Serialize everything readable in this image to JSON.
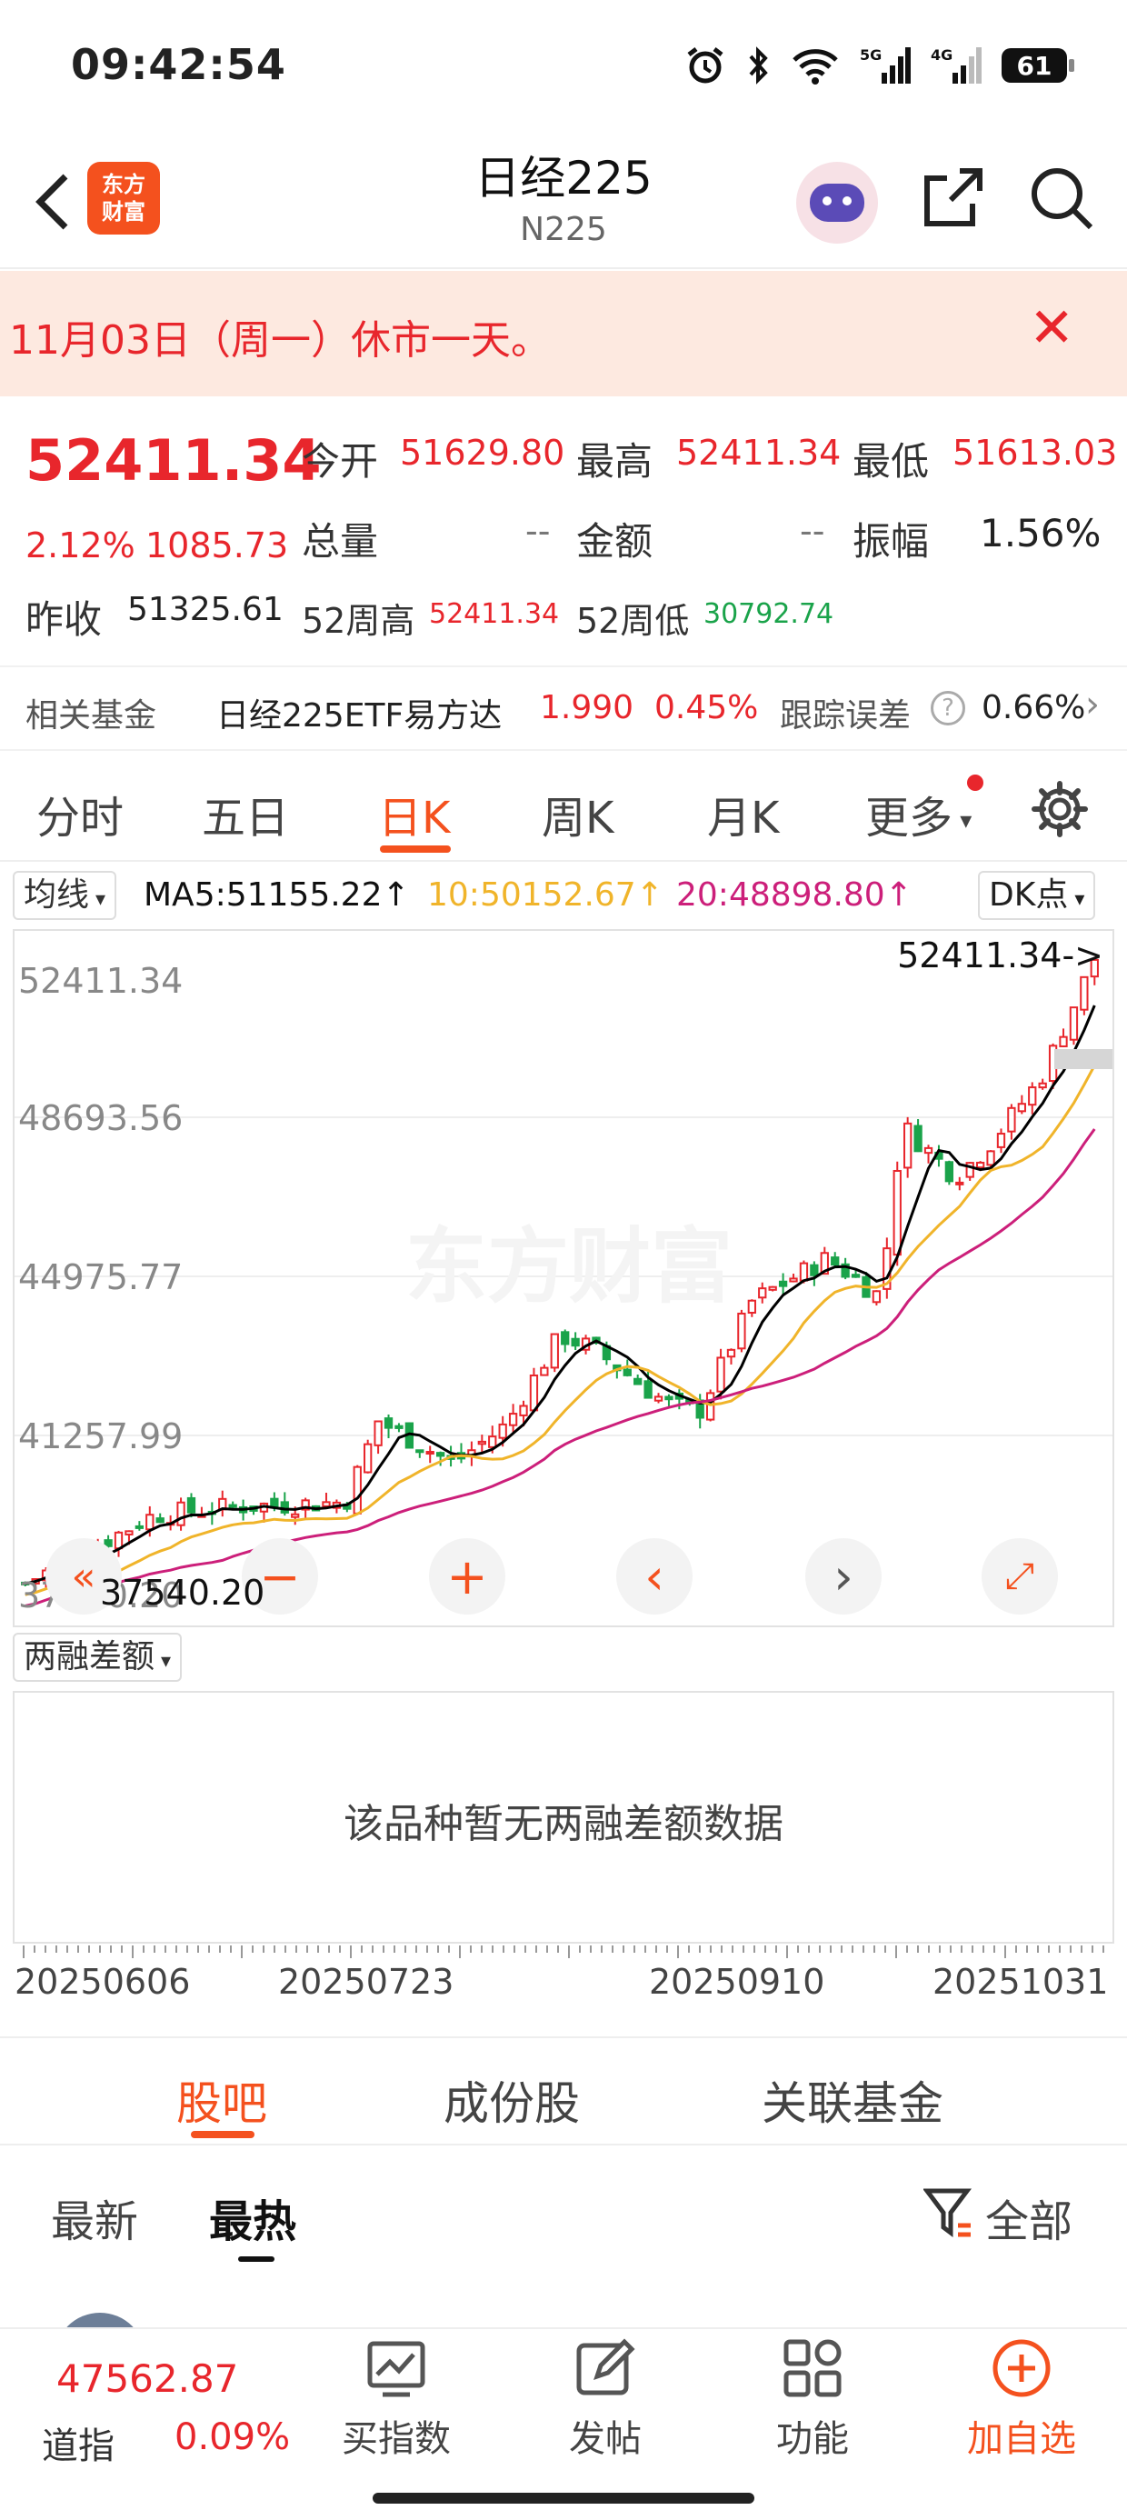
{
  "status": {
    "time": "09:42:54",
    "battery": "61"
  },
  "header": {
    "logo": "东方\n财富",
    "title": "日经225",
    "code": "N225"
  },
  "banner": {
    "text": "11月03日（周一）休市一天。"
  },
  "quote": {
    "price": "52411.34",
    "change_pct": "2.12%",
    "change": "1085.73",
    "rows": [
      [
        {
          "label": "今开",
          "value": "51629.80",
          "color": "red"
        },
        {
          "label": "最高",
          "value": "52411.34",
          "color": "red"
        },
        {
          "label": "最低",
          "value": "51613.03",
          "color": "red"
        }
      ],
      [
        {
          "label": "总量",
          "value": "--",
          "color": "grey"
        },
        {
          "label": "金额",
          "value": "--",
          "color": "grey"
        },
        {
          "label": "振幅",
          "value": "1.56%",
          "color": "dark"
        }
      ]
    ],
    "prev_label": "昨收",
    "prev_value": "51325.61",
    "wk_high_label": "52周高",
    "wk_high_value": "52411.34",
    "wk_low_label": "52周低",
    "wk_low_value": "30792.74"
  },
  "fund": {
    "label": "相关基金",
    "name": "日经225ETF易方达",
    "price": "1.990",
    "pct": "0.45%",
    "err_label": "跟踪误差",
    "err_value": "0.66%"
  },
  "tabs": [
    "分时",
    "五日",
    "日K",
    "周K",
    "月K",
    "更多"
  ],
  "active_tab": 2,
  "ma": {
    "selector": "均线",
    "ma5": "MA5:51155.22↑",
    "ma10": "10:50152.67↑",
    "ma20": "20:48898.80↑",
    "dk": "DK点"
  },
  "chart_data": {
    "type": "candlestick",
    "title": "",
    "y_labels": [
      "52411.34",
      "48693.56",
      "44975.77",
      "41257.99",
      "37540.20"
    ],
    "ylim": [
      37540.2,
      52411.34
    ],
    "x_labels": [
      "20250606",
      "20250723",
      "20250910",
      "20251031"
    ],
    "last_price_label": "52411.34->",
    "min_label": "37540.20",
    "series": [
      {
        "name": "MA5",
        "color": "#000000"
      },
      {
        "name": "10",
        "color": "#f0b42a"
      },
      {
        "name": "20",
        "color": "#cc1f7a"
      }
    ]
  },
  "sub_chart": {
    "selector": "两融差额",
    "empty_text": "该品种暂无两融差额数据"
  },
  "bottom_tabs": [
    "股吧",
    "成份股",
    "关联基金"
  ],
  "feed_tabs": [
    "最新",
    "最热"
  ],
  "filter": "全部",
  "nav": {
    "ticker_price": "47562.87",
    "ticker_name": "道指",
    "ticker_pct": "0.09%",
    "items": [
      "买指数",
      "发帖",
      "功能",
      "加自选"
    ]
  }
}
